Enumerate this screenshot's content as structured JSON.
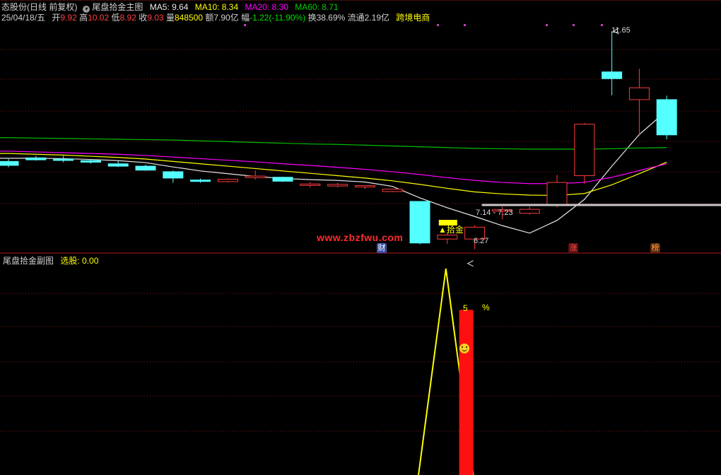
{
  "header": {
    "name_partial": "态股份",
    "period_mode": "(日线 前复权)",
    "indicator_name": "尾盘拾金主图",
    "ma5_label": "MA5:",
    "ma5_value": "9.64",
    "ma10_label": "MA10:",
    "ma10_value": "8.34",
    "ma20_label": "MA20:",
    "ma20_value": "8.30",
    "ma60_label": "MA60:",
    "ma60_value": "8.71",
    "date": "25/04/18/五",
    "open_label": "开",
    "open_value": "9.92",
    "high_label": "高",
    "high_value": "10.02",
    "low_label": "低",
    "low_value": "8.92",
    "close_label": "收",
    "close_value": "9.03",
    "volume_label": "量",
    "volume_value": "848500",
    "amount_label": "额",
    "amount_value": "7.90亿",
    "change_label": "幅",
    "change_value": "-1.22(-11.90%)",
    "turnover_label": "换",
    "turnover_value": "38.69%",
    "float_label": "流通",
    "float_value": "2.19亿",
    "sector": "跨境电商"
  },
  "annotations": {
    "high_marker": "11.65",
    "low_marker": "6.27",
    "range_label": "7.14 - 7.23",
    "signal_label": "▲拾金",
    "watermark": "www.zbzfwu.com",
    "event_cai": "财",
    "event_zhang": "涨",
    "event_bang": "榜"
  },
  "sub_header": {
    "indicator_name": "尾盘拾金副图",
    "select_label": "选股:",
    "select_value": "0.00",
    "percent_number": "5",
    "percent_sign": "%"
  },
  "colors": {
    "up": "#ff3b3b",
    "down": "#54ffff",
    "ma5": "#e8e8e8",
    "ma10": "#ffff00",
    "ma20": "#ff00ff",
    "ma60": "#00c000",
    "grid": "#8b1a1a",
    "signal": "#ffff00"
  },
  "chart_data": {
    "type": "candlestick",
    "title": "尾盘拾金主图",
    "candles": [
      {
        "o": 8.36,
        "h": 8.42,
        "l": 8.21,
        "c": 8.26
      },
      {
        "o": 8.45,
        "h": 8.5,
        "l": 8.38,
        "c": 8.4
      },
      {
        "o": 8.42,
        "h": 8.5,
        "l": 8.34,
        "c": 8.41
      },
      {
        "o": 8.38,
        "h": 8.42,
        "l": 8.3,
        "c": 8.34
      },
      {
        "o": 8.3,
        "h": 8.38,
        "l": 8.22,
        "c": 8.24
      },
      {
        "o": 8.24,
        "h": 8.28,
        "l": 8.12,
        "c": 8.14
      },
      {
        "o": 8.1,
        "h": 8.13,
        "l": 7.82,
        "c": 7.94
      },
      {
        "o": 7.89,
        "h": 7.93,
        "l": 7.82,
        "c": 7.86
      },
      {
        "o": 7.85,
        "h": 7.93,
        "l": 7.83,
        "c": 7.91
      },
      {
        "o": 7.95,
        "h": 8.13,
        "l": 7.9,
        "c": 7.99
      },
      {
        "o": 7.96,
        "h": 7.97,
        "l": 7.84,
        "c": 7.86
      },
      {
        "o": 7.78,
        "h": 7.84,
        "l": 7.7,
        "c": 7.79
      },
      {
        "o": 7.74,
        "h": 7.82,
        "l": 7.7,
        "c": 7.78
      },
      {
        "o": 7.72,
        "h": 7.76,
        "l": 7.66,
        "c": 7.75
      },
      {
        "o": 7.6,
        "h": 7.67,
        "l": 7.58,
        "c": 7.66
      },
      {
        "o": 7.35,
        "h": 7.35,
        "l": 6.27,
        "c": 6.3
      },
      {
        "o": 6.4,
        "h": 6.58,
        "l": 6.28,
        "c": 6.5
      },
      {
        "o": 6.4,
        "h": 6.75,
        "l": 6.14,
        "c": 6.7
      },
      {
        "o": 7.12,
        "h": 7.22,
        "l": 6.9,
        "c": 7.14
      },
      {
        "o": 7.05,
        "h": 7.22,
        "l": 7.02,
        "c": 7.15
      },
      {
        "o": 7.25,
        "h": 8.02,
        "l": 7.2,
        "c": 7.83
      },
      {
        "o": 8.0,
        "h": 9.33,
        "l": 7.8,
        "c": 9.3
      },
      {
        "o": 10.62,
        "h": 11.65,
        "l": 10.03,
        "c": 10.45
      },
      {
        "o": 9.92,
        "h": 10.7,
        "l": 9.0,
        "c": 10.22
      },
      {
        "o": 9.92,
        "h": 10.02,
        "l": 8.92,
        "c": 9.03
      }
    ],
    "ma_series": [
      {
        "name": "MA5",
        "values": [
          8.44,
          8.44,
          8.43,
          8.41,
          8.38,
          8.33,
          8.22,
          8.12,
          8.05,
          7.98,
          7.93,
          7.9,
          7.88,
          7.84,
          7.73,
          7.44,
          7.19,
          6.97,
          6.74,
          6.55,
          6.87,
          7.4,
          8.24,
          9.04,
          9.64
        ]
      },
      {
        "name": "MA10",
        "values": [
          8.56,
          8.54,
          8.52,
          8.49,
          8.46,
          8.42,
          8.36,
          8.3,
          8.24,
          8.18,
          8.12,
          8.06,
          8.0,
          7.94,
          7.87,
          7.78,
          7.68,
          7.59,
          7.54,
          7.51,
          7.5,
          7.55,
          7.77,
          8.05,
          8.34
        ]
      },
      {
        "name": "MA20",
        "values": [
          8.62,
          8.6,
          8.58,
          8.56,
          8.54,
          8.51,
          8.47,
          8.43,
          8.39,
          8.35,
          8.3,
          8.26,
          8.21,
          8.16,
          8.1,
          8.03,
          7.95,
          7.88,
          7.83,
          7.8,
          7.8,
          7.83,
          7.96,
          8.13,
          8.3
        ]
      },
      {
        "name": "MA60",
        "values": [
          8.96,
          8.95,
          8.94,
          8.93,
          8.92,
          8.91,
          8.9,
          8.88,
          8.86,
          8.84,
          8.82,
          8.8,
          8.79,
          8.77,
          8.75,
          8.73,
          8.71,
          8.69,
          8.68,
          8.67,
          8.67,
          8.67,
          8.68,
          8.7,
          8.71
        ]
      }
    ],
    "price_range": [
      6.1,
      11.9
    ],
    "sub_chart": {
      "title": "尾盘拾金副图",
      "line": [
        null,
        null,
        null,
        null,
        null,
        null,
        null,
        null,
        null,
        null,
        null,
        null,
        null,
        null,
        null,
        0,
        100,
        0,
        null,
        null,
        null,
        null,
        null,
        null,
        null
      ],
      "bar_index": 16,
      "bar_value": 80,
      "range": [
        0,
        100
      ]
    }
  }
}
